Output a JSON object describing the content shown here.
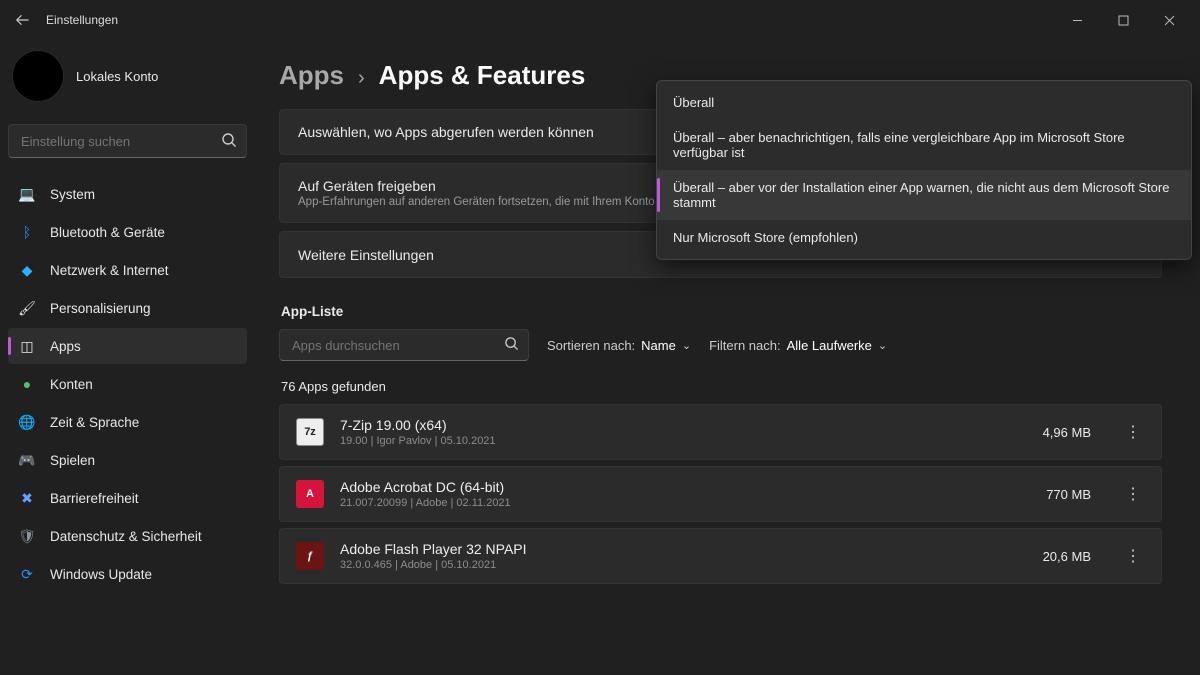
{
  "window": {
    "title": "Einstellungen"
  },
  "account": {
    "name": "Lokales Konto"
  },
  "search": {
    "placeholder": "Einstellung suchen"
  },
  "sidebar": {
    "items": [
      {
        "label": "System"
      },
      {
        "label": "Bluetooth & Geräte"
      },
      {
        "label": "Netzwerk & Internet"
      },
      {
        "label": "Personalisierung"
      },
      {
        "label": "Apps"
      },
      {
        "label": "Konten"
      },
      {
        "label": "Zeit & Sprache"
      },
      {
        "label": "Spielen"
      },
      {
        "label": "Barrierefreiheit"
      },
      {
        "label": "Datenschutz & Sicherheit"
      },
      {
        "label": "Windows Update"
      }
    ]
  },
  "breadcrumb": {
    "root": "Apps",
    "leaf": "Apps & Features"
  },
  "cards": {
    "source": {
      "title": "Auswählen, wo Apps abgerufen werden können"
    },
    "share": {
      "title": "Auf Geräten freigeben",
      "sub": "App-Erfahrungen auf anderen Geräten fortsetzen, die mit Ihrem Konto verbunden sind"
    },
    "more": {
      "title": "Weitere Einstellungen"
    }
  },
  "dropdown": {
    "options": [
      "Überall",
      "Überall – aber benachrichtigen, falls eine vergleichbare App im Microsoft Store verfügbar ist",
      "Überall – aber vor der Installation einer App warnen, die nicht aus dem Microsoft Store stammt",
      "Nur Microsoft Store (empfohlen)"
    ],
    "selected_index": 2
  },
  "applist": {
    "section_label": "App-Liste",
    "search_placeholder": "Apps durchsuchen",
    "sort_label": "Sortieren nach:",
    "sort_value": "Name",
    "filter_label": "Filtern nach:",
    "filter_value": "Alle Laufwerke",
    "count_text": "76 Apps gefunden",
    "items": [
      {
        "name": "7-Zip 19.00 (x64)",
        "sub": "19.00  |  Igor Pavlov  |  05.10.2021",
        "size": "4,96 MB",
        "icon": "7z"
      },
      {
        "name": "Adobe Acrobat DC (64-bit)",
        "sub": "21.007.20099  |  Adobe  |  02.11.2021",
        "size": "770 MB",
        "icon": "A"
      },
      {
        "name": "Adobe Flash Player 32 NPAPI",
        "sub": "32.0.0.465  |  Adobe  |  05.10.2021",
        "size": "20,6 MB",
        "icon": "ƒ"
      }
    ]
  }
}
